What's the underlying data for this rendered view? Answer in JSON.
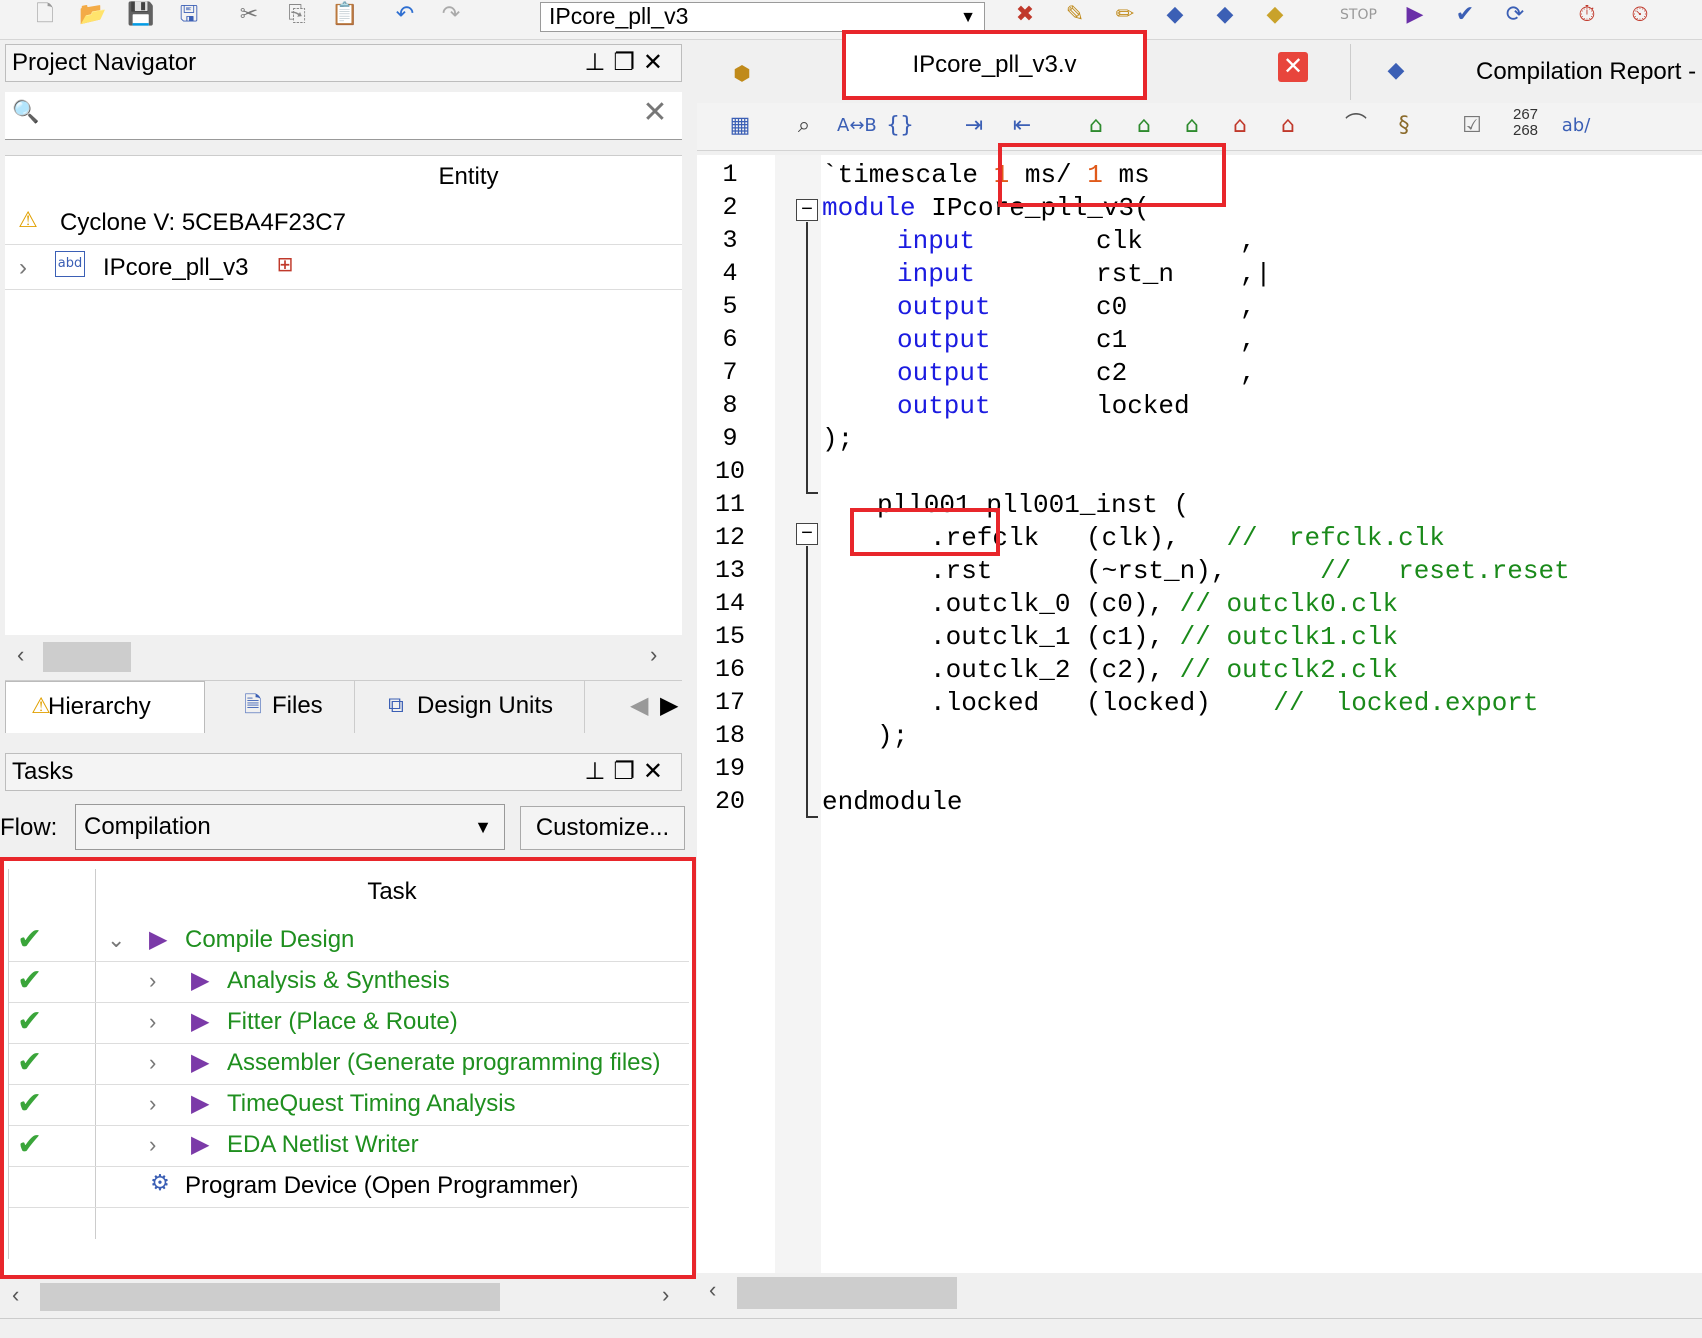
{
  "toolbar": {
    "project_name": "IPcore_pll_v3",
    "icons": [
      "new-file-icon",
      "open-folder-icon",
      "save-icon",
      "save-all-icon",
      "cut-icon",
      "copy-icon",
      "paste-icon",
      "undo-icon",
      "redo-icon",
      "chip-planner-icon",
      "pin-planner-icon",
      "settings-icon",
      "analysis-icon",
      "synthesis-icon",
      "fitter-icon",
      "stop-icon",
      "start-compilation-icon",
      "compile-check-icon",
      "timing-icon",
      "netlist-icon",
      "programmer-icon"
    ]
  },
  "nav": {
    "title": "Project Navigator",
    "entity_header": "Entity",
    "device": "Cyclone V: 5CEBA4F23C7",
    "top_entity": "IPcore_pll_v3",
    "tabs": [
      "Hierarchy",
      "Files",
      "Design Units"
    ]
  },
  "tasks": {
    "title": "Tasks",
    "flow_label": "Flow:",
    "flow_value": "Compilation",
    "customize": "Customize...",
    "column_header": "Task",
    "items": [
      {
        "label": "Compile Design",
        "done": true
      },
      {
        "label": "Analysis & Synthesis",
        "done": true
      },
      {
        "label": "Fitter (Place & Route)",
        "done": true
      },
      {
        "label": "Assembler (Generate programming files)",
        "done": true
      },
      {
        "label": "TimeQuest Timing Analysis",
        "done": true
      },
      {
        "label": "EDA Netlist Writer",
        "done": true
      },
      {
        "label": "Program Device (Open Programmer)",
        "done": false
      }
    ]
  },
  "editor": {
    "file_tab": "IPcore_pll_v3.v",
    "report_tab": "Compilation Report - I",
    "line_counter_top": "267",
    "line_counter_bottom": "268",
    "line_numbers": [
      "1",
      "2",
      "3",
      "4",
      "5",
      "6",
      "7",
      "8",
      "9",
      "10",
      "11",
      "12",
      "13",
      "14",
      "15",
      "16",
      "17",
      "18",
      "19",
      "20"
    ],
    "code": {
      "l1a": "`timescale ",
      "l1b": "1",
      "l1c": " ms/ ",
      "l1d": "1",
      "l1e": " ms",
      "l2a": "module",
      "l2b": " IPcore_pll_v3(",
      "l3a": "input",
      "l3b": "clk",
      "l3c": ",",
      "l4a": "input",
      "l4b": "rst_n",
      "l4c": ",|",
      "l5a": "output",
      "l5b": "c0",
      "l5c": ",",
      "l6a": "output",
      "l6b": "c1",
      "l6c": ",",
      "l7a": "output",
      "l7b": "c2",
      "l7c": ",",
      "l8a": "output",
      "l8b": "locked",
      "l9": ");",
      "l11a": "pll001",
      "l11b": " pll001_inst (",
      "l12a": ".refclk   (clk),   ",
      "l12b": "//  refclk.clk",
      "l13a": ".rst      (~rst_n),      ",
      "l13b": "//   reset.reset",
      "l14a": ".outclk_0 (c0), ",
      "l14b": "// outclk0.clk",
      "l15a": ".outclk_1 (c1), ",
      "l15b": "// outclk1.clk",
      "l16a": ".outclk_2 (c2), ",
      "l16b": "// outclk2.clk",
      "l17a": ".locked   (locked)    ",
      "l17b": "//  locked.export",
      "l18": ");",
      "l20": "endmodule"
    }
  }
}
